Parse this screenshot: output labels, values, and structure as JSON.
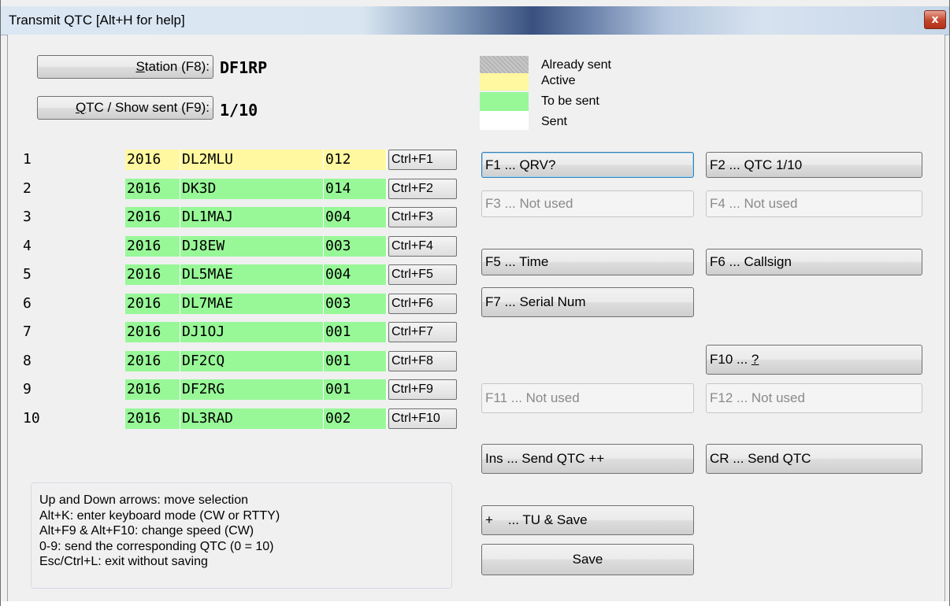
{
  "window": {
    "title": "Transmit QTC [Alt+H for help]",
    "close_glyph": "x"
  },
  "station": {
    "button_pre": "",
    "button_ul": "S",
    "button_post": "tation (F8):",
    "value": "DF1RP"
  },
  "qtc": {
    "button_pre": "",
    "button_ul": "Q",
    "button_post": "TC / Show sent (F9):",
    "value": "1/10"
  },
  "legend": [
    {
      "label": "Already sent",
      "color": "#c0c0c0"
    },
    {
      "label": "Active",
      "color": "#fff8a0"
    },
    {
      "label": "To be sent",
      "color": "#98f898"
    },
    {
      "label": "Sent",
      "color": "#ffffff"
    }
  ],
  "qtc_rows": [
    {
      "num": "1",
      "time": "2016",
      "call": "DL2MLU",
      "serial": "012",
      "key": "Ctrl+F1",
      "state": "active"
    },
    {
      "num": "2",
      "time": "2016",
      "call": "DK3D",
      "serial": "014",
      "key": "Ctrl+F2",
      "state": "tobesent"
    },
    {
      "num": "3",
      "time": "2016",
      "call": "DL1MAJ",
      "serial": "004",
      "key": "Ctrl+F3",
      "state": "tobesent"
    },
    {
      "num": "4",
      "time": "2016",
      "call": "DJ8EW",
      "serial": "003",
      "key": "Ctrl+F4",
      "state": "tobesent"
    },
    {
      "num": "5",
      "time": "2016",
      "call": "DL5MAE",
      "serial": "004",
      "key": "Ctrl+F5",
      "state": "tobesent"
    },
    {
      "num": "6",
      "time": "2016",
      "call": "DL7MAE",
      "serial": "003",
      "key": "Ctrl+F6",
      "state": "tobesent"
    },
    {
      "num": "7",
      "time": "2016",
      "call": "DJ1OJ",
      "serial": "001",
      "key": "Ctrl+F7",
      "state": "tobesent"
    },
    {
      "num": "8",
      "time": "2016",
      "call": "DF2CQ",
      "serial": "001",
      "key": "Ctrl+F8",
      "state": "tobesent"
    },
    {
      "num": "9",
      "time": "2016",
      "call": "DF2RG",
      "serial": "001",
      "key": "Ctrl+F9",
      "state": "tobesent"
    },
    {
      "num": "10",
      "time": "2016",
      "call": "DL3RAD",
      "serial": "002",
      "key": "Ctrl+F10",
      "state": "tobesent"
    }
  ],
  "fkeys": {
    "f1": "F1 ... QRV?",
    "f2": "F2 ... QTC 1/10",
    "f3": "F3 ... Not used",
    "f4": "F4 ... Not used",
    "f5": "F5 ... Time",
    "f6": "F6 ... Callsign",
    "f7": "F7 ... Serial Num",
    "f10_pre": "F10 ... ",
    "f10_ul": "?",
    "f11": "F11 ... Not used",
    "f12": "F12 ... Not used",
    "ins": "Ins ... Send QTC ++",
    "cr": "CR ... Send QTC",
    "plus": "+    ... TU & Save",
    "save": "Save"
  },
  "help_lines": [
    "Up and Down arrows: move selection",
    "Alt+K: enter keyboard mode (CW or RTTY)",
    "Alt+F9 & Alt+F10: change speed (CW)",
    "0-9: send the corresponding QTC (0 = 10)",
    "Esc/Ctrl+L: exit without saving"
  ]
}
